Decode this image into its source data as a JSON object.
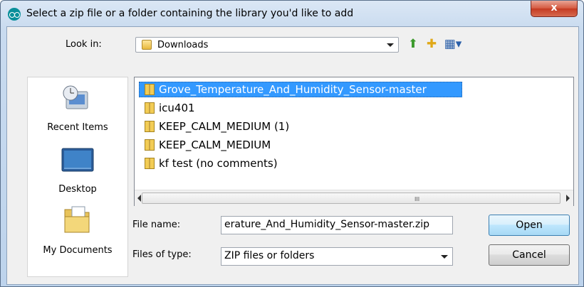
{
  "window": {
    "title": "Select a zip file or a folder containing the library you'd like to add",
    "close_label": "x"
  },
  "toolbar": {
    "look_in_label": "Look in:",
    "look_in_value": "Downloads",
    "icons": [
      "up-folder-icon",
      "new-folder-icon",
      "view-menu-icon"
    ]
  },
  "places": [
    {
      "label": "Recent Items",
      "icon": "recent-items-icon"
    },
    {
      "label": "Desktop",
      "icon": "desktop-icon"
    },
    {
      "label": "My Documents",
      "icon": "my-documents-icon"
    }
  ],
  "files": [
    {
      "name": "Grove_Temperature_And_Humidity_Sensor-master",
      "selected": true
    },
    {
      "name": "icu401",
      "selected": false
    },
    {
      "name": "KEEP_CALM_MEDIUM (1)",
      "selected": false
    },
    {
      "name": "KEEP_CALM_MEDIUM",
      "selected": false
    },
    {
      "name": "kf test (no comments)",
      "selected": false
    }
  ],
  "scrollbar_grip": "III",
  "file_name_label": "File name:",
  "file_name_value": "erature_And_Humidity_Sensor-master.zip",
  "file_type_label": "Files of type:",
  "file_type_value": "ZIP files or folders",
  "buttons": {
    "open": "Open",
    "cancel": "Cancel"
  }
}
